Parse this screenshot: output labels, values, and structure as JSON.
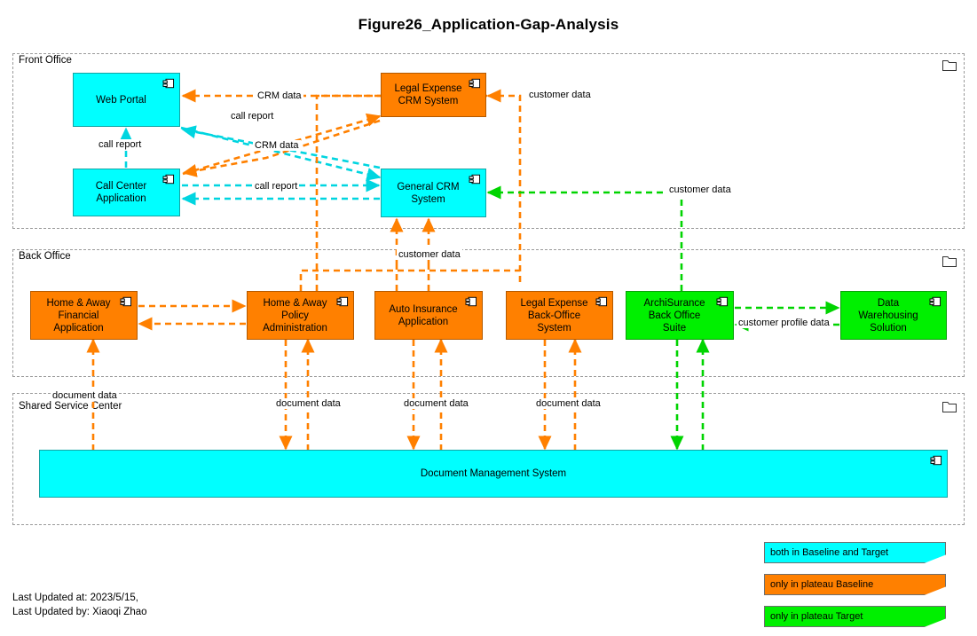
{
  "title": "Figure26_Application-Gap-Analysis",
  "colors": {
    "baseline_and_target": "#00FFFF",
    "only_baseline": "#FF8000",
    "only_target": "#00F000",
    "group_border": "#9A9A9A"
  },
  "groups": [
    {
      "id": "front-office",
      "label": "Front Office",
      "icon": "folder-icon"
    },
    {
      "id": "back-office",
      "label": "Back Office",
      "icon": "folder-icon"
    },
    {
      "id": "shared-service-center",
      "label": "Shared Service Center",
      "icon": "folder-icon"
    }
  ],
  "nodes": [
    {
      "id": "web-portal",
      "label": "Web Portal",
      "color": "cyan",
      "group": "front-office",
      "icon": "application-component-icon"
    },
    {
      "id": "legal-expense-crm",
      "label": "Legal Expense\nCRM System",
      "color": "orange",
      "group": "front-office",
      "icon": "application-component-icon"
    },
    {
      "id": "call-center-app",
      "label": "Call Center\nApplication",
      "color": "cyan",
      "group": "front-office",
      "icon": "application-component-icon"
    },
    {
      "id": "general-crm",
      "label": "General CRM\nSystem",
      "color": "cyan",
      "group": "front-office",
      "icon": "application-component-icon"
    },
    {
      "id": "ha-financial",
      "label": "Home & Away\nFinancial\nApplication",
      "color": "orange",
      "group": "back-office",
      "icon": "application-component-icon"
    },
    {
      "id": "ha-policy",
      "label": "Home & Away\nPolicy\nAdministration",
      "color": "orange",
      "group": "back-office",
      "icon": "application-component-icon"
    },
    {
      "id": "auto-insurance",
      "label": "Auto Insurance\nApplication",
      "color": "orange",
      "group": "back-office",
      "icon": "application-component-icon"
    },
    {
      "id": "legal-expense-bo",
      "label": "Legal Expense\nBack-Office\nSystem",
      "color": "orange",
      "group": "back-office",
      "icon": "application-component-icon"
    },
    {
      "id": "archisurance-bo",
      "label": "ArchiSurance\nBack Office\nSuite",
      "color": "green",
      "group": "back-office",
      "icon": "application-component-icon"
    },
    {
      "id": "data-warehousing",
      "label": "Data\nWarehousing\nSolution",
      "color": "green",
      "group": "back-office",
      "icon": "application-component-icon"
    },
    {
      "id": "dms",
      "label": "Document Management System",
      "color": "cyan",
      "group": "shared-service-center",
      "icon": "application-component-icon"
    }
  ],
  "edge_labels": {
    "crm_data_top": "CRM data",
    "call_report_top": "call report",
    "call_report_left": "call report",
    "crm_data_mid": "CRM data",
    "call_report_bottom": "call report",
    "customer_data_legal": "customer data",
    "customer_data_crm": "customer data",
    "customer_data_back": "customer data",
    "customer_profile_data": "customer profile data",
    "document_data_1": "document data",
    "document_data_2": "document data",
    "document_data_3": "document data",
    "document_data_4": "document data"
  },
  "legend": [
    {
      "id": "legend-baseline-target",
      "label": "both in Baseline and Target",
      "color": "cyan"
    },
    {
      "id": "legend-baseline",
      "label": "only in plateau Baseline",
      "color": "orange"
    },
    {
      "id": "legend-target",
      "label": "only in plateau Target",
      "color": "green"
    }
  ],
  "footer": "Last Updated at: 2023/5/15,\nLast Updated by: Xiaoqi Zhao"
}
